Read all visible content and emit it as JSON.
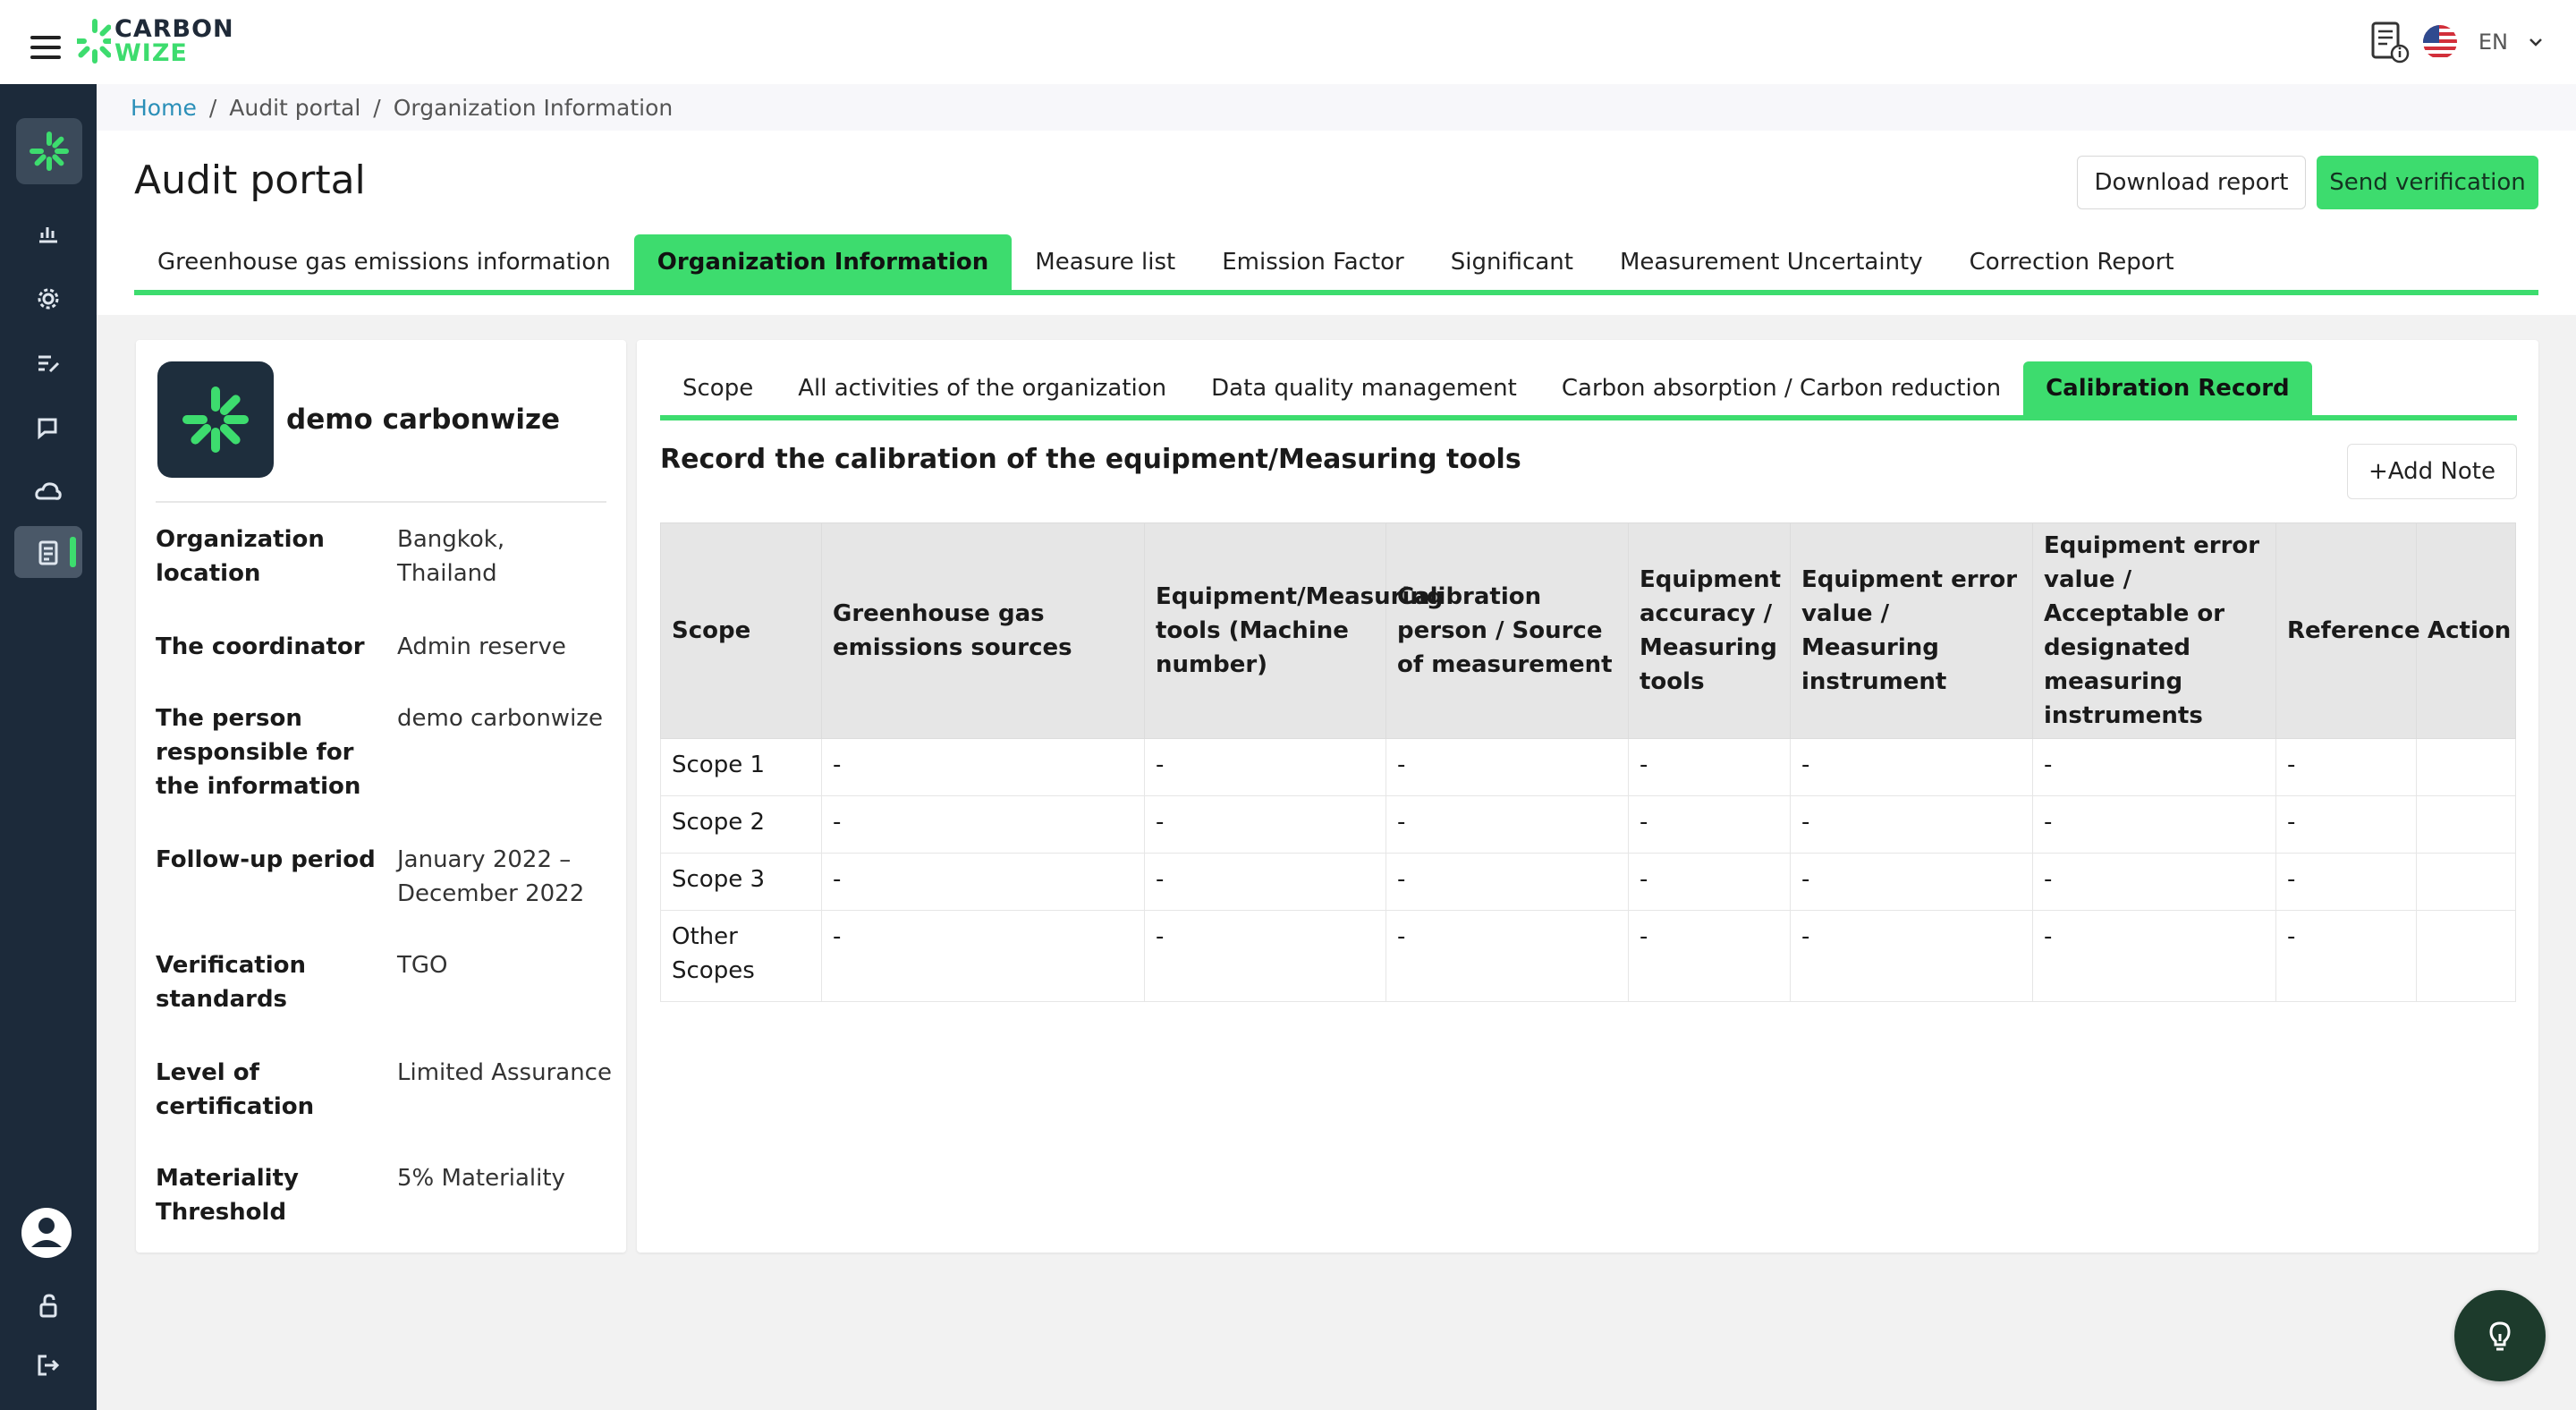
{
  "app": {
    "logo_line1": "CARBON",
    "logo_line2": "WIZE",
    "language": "EN",
    "accent_color": "#3ddc6e",
    "sidebar_color": "#1c2a3a"
  },
  "breadcrumb": {
    "items": [
      "Home",
      "Audit portal",
      "Organization Information"
    ],
    "separator": "/"
  },
  "page": {
    "title": "Audit portal",
    "download_label": "Download report",
    "send_label": "Send verification"
  },
  "main_tabs": [
    {
      "label": "Greenhouse gas emissions information",
      "active": false
    },
    {
      "label": "Organization Information",
      "active": true
    },
    {
      "label": "Measure list",
      "active": false
    },
    {
      "label": "Emission Factor",
      "active": false
    },
    {
      "label": "Significant",
      "active": false
    },
    {
      "label": "Measurement Uncertainty",
      "active": false
    },
    {
      "label": "Correction Report",
      "active": false
    }
  ],
  "organization": {
    "name": "demo carbonwize",
    "fields": [
      {
        "label": "Organization location",
        "value": "Bangkok, Thailand"
      },
      {
        "label": "The coordinator",
        "value": "Admin reserve"
      },
      {
        "label": "The person responsible for the information",
        "value": "demo carbonwize"
      },
      {
        "label": "Follow-up period",
        "value": "January 2022 – December 2022"
      },
      {
        "label": "Verification standards",
        "value": "TGO"
      },
      {
        "label": "Level of certification",
        "value": "Limited Assurance"
      },
      {
        "label": "Materiality Threshold",
        "value": "5% Materiality"
      }
    ]
  },
  "sub_tabs": [
    {
      "label": "Scope",
      "active": false
    },
    {
      "label": "All activities of the organization",
      "active": false
    },
    {
      "label": "Data quality management",
      "active": false
    },
    {
      "label": "Carbon absorption / Carbon reduction",
      "active": false
    },
    {
      "label": "Calibration Record",
      "active": true
    }
  ],
  "calibration": {
    "title": "Record the calibration of the equipment/Measuring tools",
    "add_note_label": "+Add Note",
    "columns": [
      "Scope",
      "Greenhouse gas emissions sources",
      "Equipment/Measuring tools (Machine number)",
      "Calibration person / Source of measurement",
      "Equipment accuracy / Measuring tools",
      "Equipment error value / Measuring instrument",
      "Equipment error value / Acceptable or designated measuring instruments",
      "Reference",
      "Action"
    ],
    "rows": [
      [
        "Scope 1",
        "-",
        "-",
        "-",
        "-",
        "-",
        "-",
        "-",
        ""
      ],
      [
        "Scope 2",
        "-",
        "-",
        "-",
        "-",
        "-",
        "-",
        "-",
        ""
      ],
      [
        "Scope 3",
        "-",
        "-",
        "-",
        "-",
        "-",
        "-",
        "-",
        ""
      ],
      [
        "Other Scopes",
        "-",
        "-",
        "-",
        "-",
        "-",
        "-",
        "-",
        ""
      ]
    ]
  },
  "icons": {
    "menu": "hamburger-icon",
    "report": "report-info-icon",
    "flag": "us-flag-icon",
    "dropdown": "chevron-down-icon",
    "fab": "lightbulb-icon"
  }
}
